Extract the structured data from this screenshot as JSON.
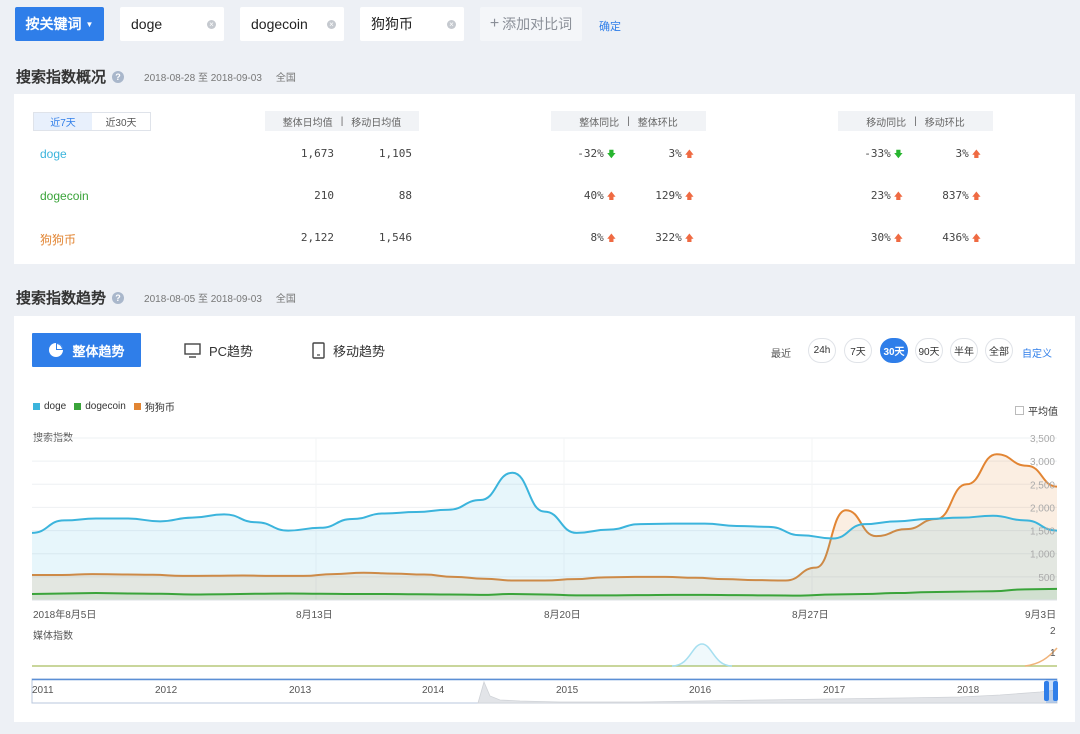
{
  "topbar": {
    "mode_label": "按关键词",
    "keywords": [
      "doge",
      "dogecoin",
      "狗狗币"
    ],
    "add_compare": "添加对比词",
    "confirm": "确定"
  },
  "overview": {
    "title": "搜索指数概况",
    "help": "?",
    "date_range": "2018-08-28 至 2018-09-03",
    "region": "全国",
    "tabs": [
      "近7天",
      "近30天"
    ],
    "header1": [
      "整体日均值",
      "移动日均值"
    ],
    "header2": [
      "整体同比",
      "整体环比"
    ],
    "header3": [
      "移动同比",
      "移动环比"
    ],
    "rows": [
      {
        "name": "doge",
        "total_avg": "1,673",
        "mobile_avg": "1,105",
        "yoy": "-32%",
        "mom": "3%",
        "m_yoy": "-33%",
        "m_mom": "3%",
        "color": "#3bb4dc"
      },
      {
        "name": "dogecoin",
        "total_avg": "210",
        "mobile_avg": "88",
        "yoy": "40%",
        "mom": "129%",
        "m_yoy": "23%",
        "m_mom": "837%",
        "color": "#3aa43a"
      },
      {
        "name": "狗狗币",
        "total_avg": "2,122",
        "mobile_avg": "1,546",
        "yoy": "8%",
        "mom": "322%",
        "m_yoy": "30%",
        "m_mom": "436%",
        "color": "#e28533"
      }
    ]
  },
  "trend": {
    "title": "搜索指数趋势",
    "help": "?",
    "date_range": "2018-08-05 至 2018-09-03",
    "region": "全国",
    "tabs": [
      "整体趋势",
      "PC趋势",
      "移动趋势"
    ],
    "range_label": "最近",
    "ranges": [
      "24h",
      "7天",
      "30天",
      "90天",
      "半年",
      "全部"
    ],
    "selected_range": "30天",
    "custom": "自定义",
    "average_label": "平均值",
    "search_label": "搜索指数",
    "media_label": "媒体指数"
  },
  "chart_data": [
    {
      "type": "area",
      "ylabel": "搜索指数",
      "ylim": [
        0,
        3500
      ],
      "yticks": [
        "500",
        "1,000",
        "1,500",
        "2,000",
        "2,500",
        "3,000",
        "3,500"
      ],
      "x_labels": [
        "2018年8月5日",
        "8月13日",
        "8月20日",
        "8月27日",
        "9月3日"
      ],
      "series": [
        {
          "name": "doge",
          "color": "#3bb4dc",
          "values": [
            1450,
            1720,
            1760,
            1760,
            1700,
            1780,
            1850,
            1680,
            1500,
            1560,
            1750,
            1870,
            1900,
            1950,
            2160,
            2750,
            1910,
            1450,
            1520,
            1640,
            1650,
            1650,
            1600,
            1580,
            1400,
            1330,
            1640,
            1700,
            1750,
            1780,
            1820,
            1720,
            1500
          ]
        },
        {
          "name": "dogecoin",
          "color": "#3aa43a",
          "values": [
            130,
            140,
            150,
            140,
            135,
            120,
            125,
            135,
            140,
            135,
            130,
            130,
            125,
            120,
            110,
            130,
            120,
            100,
            100,
            105,
            110,
            110,
            105,
            100,
            95,
            120,
            130,
            150,
            170,
            180,
            190,
            230,
            240
          ]
        },
        {
          "name": "狗狗币",
          "color": "#e28533",
          "values": [
            540,
            540,
            560,
            550,
            545,
            520,
            525,
            530,
            520,
            520,
            560,
            590,
            570,
            550,
            500,
            460,
            420,
            420,
            450,
            490,
            500,
            500,
            480,
            450,
            430,
            420,
            700,
            1940,
            1380,
            1530,
            1750,
            2500,
            3150,
            2900,
            2450
          ]
        }
      ]
    },
    {
      "type": "line",
      "ylabel": "媒体指数",
      "yticks": [
        "1",
        "2"
      ],
      "x_labels": [
        "2011",
        "2012",
        "2013",
        "2014",
        "2015",
        "2016",
        "2017",
        "2018"
      ]
    }
  ]
}
